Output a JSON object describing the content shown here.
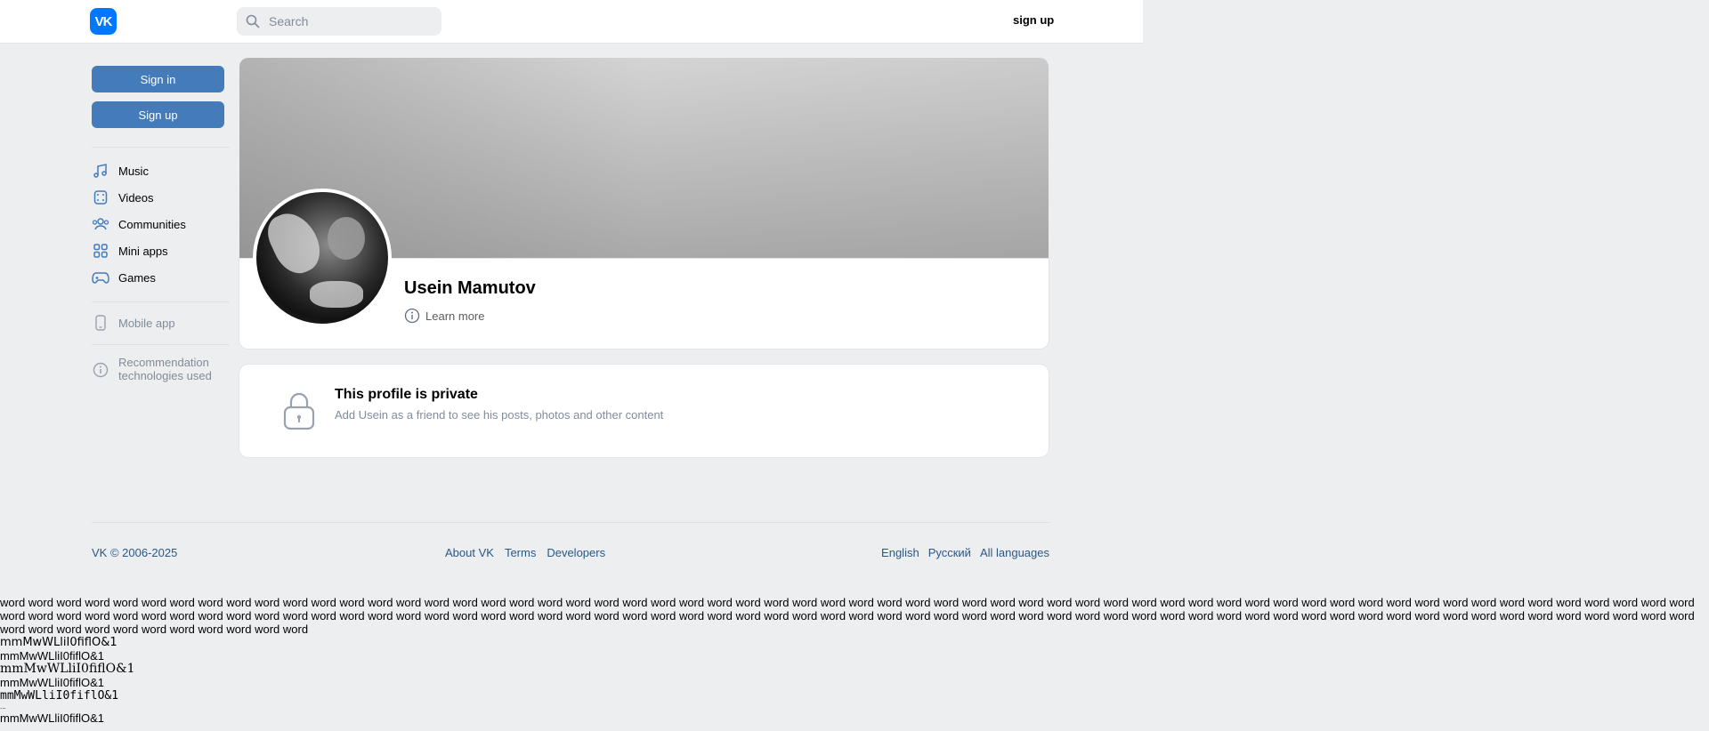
{
  "brand": {
    "logo_text": "VK",
    "accent": "#0077ff",
    "button_color": "#447bba"
  },
  "header": {
    "search_placeholder": "Search",
    "signup_label": "sign up"
  },
  "sidebar": {
    "signin_label": "Sign in",
    "signup_label": "Sign up",
    "items": [
      {
        "label": "Music",
        "icon": "music-note-icon"
      },
      {
        "label": "Videos",
        "icon": "video-film-icon"
      },
      {
        "label": "Communities",
        "icon": "communities-icon"
      },
      {
        "label": "Mini apps",
        "icon": "grid-icon"
      },
      {
        "label": "Games",
        "icon": "gamepad-icon"
      }
    ],
    "mobile_app_label": "Mobile app",
    "recommendation_label": "Recommendation technologies used"
  },
  "profile": {
    "name": "Usein Mamutov",
    "learn_more_label": "Learn more"
  },
  "private": {
    "title": "This profile is private",
    "subtitle": "Add Usein as a friend to see his posts, photos and other content"
  },
  "footer": {
    "copyright": "VK © 2006-2025",
    "links": [
      "About VK",
      "Terms",
      "Developers"
    ],
    "languages": [
      "English",
      "Русский",
      "All languages"
    ]
  },
  "debug": {
    "words": "word word word word word word word word word word word word word word word word word word word word word word word word word word word word word word word word word word word word word word word word word word word word word word word word word word word word word word word word word word word word word word word word word word word word word word word word word word word word word word word word word word word word word word word word word word word word word word word word word word word word word word word word word word word word word word word word word word word word word word word word word word word word word word word word word word word",
    "font_samples": [
      "mmMwWLliI0fiflO&1",
      "mmMwWLliI0fiflO&1",
      "mmMwWLliI0fiflO&1",
      "mmMwWLliI0fiflO&1",
      "mmMwWLliI0fiflO&1",
      "mmMwWLliI0fiflO&1"
    ],
    "ellipsis": "..."
  }
}
